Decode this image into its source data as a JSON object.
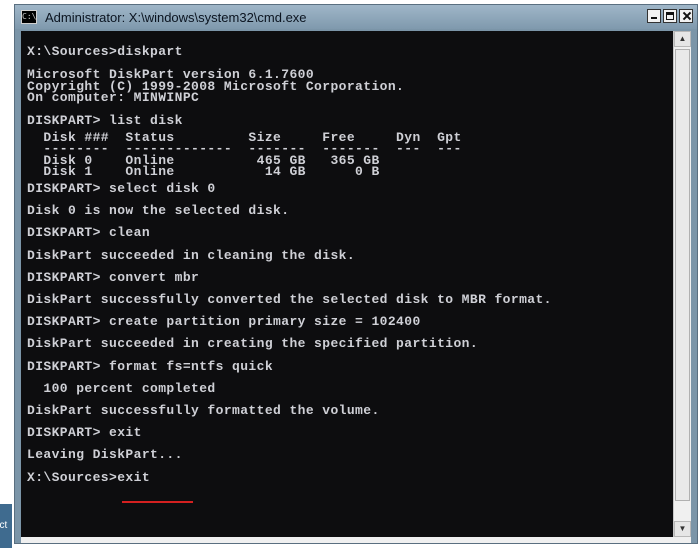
{
  "window": {
    "title": "Administrator: X:\\windows\\system32\\cmd.exe",
    "app_icon": "cmd-icon"
  },
  "console_lines": [
    "X:\\Sources>diskpart",
    "Microsoft DiskPart version 6.1.7600",
    "Copyright (C) 1999-2008 Microsoft Corporation.",
    "On computer: MINWINPC",
    "DISKPART> list disk",
    "  Disk ###  Status         Size     Free     Dyn  Gpt",
    "  --------  -------------  -------  -------  ---  ---",
    "  Disk 0    Online          465 GB   365 GB",
    "  Disk 1    Online           14 GB      0 B",
    "DISKPART> select disk 0",
    "Disk 0 is now the selected disk.",
    "DISKPART> clean",
    "DiskPart succeeded in cleaning the disk.",
    "DISKPART> convert mbr",
    "DiskPart successfully converted the selected disk to MBR format.",
    "DISKPART> create partition primary size = 102400",
    "DiskPart succeeded in creating the specified partition.",
    "DISKPART> format fs=ntfs quick",
    "  100 percent completed",
    "DiskPart successfully formatted the volume.",
    "DISKPART> exit",
    "Leaving DiskPart...",
    "X:\\Sources>exit"
  ],
  "desktop_fragment": "ect",
  "colors": {
    "console_bg": "#0d0d0f",
    "console_text": "#cfd0d6",
    "highlight_underline": "#d42020",
    "titlebar": "#8aa3b6"
  }
}
